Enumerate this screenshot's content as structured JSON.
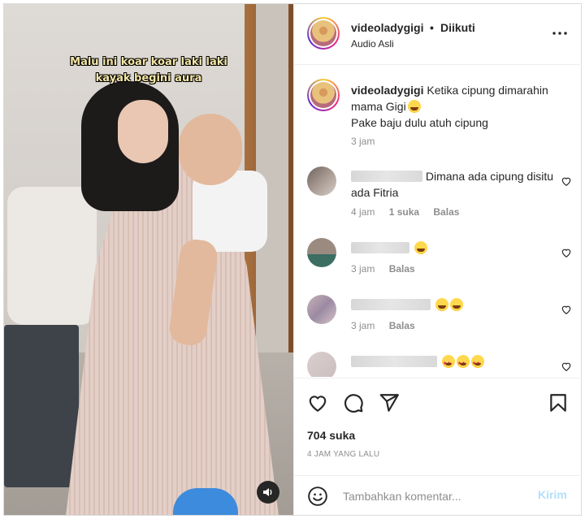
{
  "video": {
    "overlay_caption_line1": "Malu ini koar koar laki laki",
    "overlay_caption_line2": "kayak begini aura"
  },
  "header": {
    "username": "videoladygigi",
    "separator": "•",
    "follow_status": "Diikuti",
    "audio": "Audio Asli"
  },
  "caption": {
    "username": "videoladygigi",
    "text_line1": "Ketika cipung dimarahin mama Gigi",
    "text_line2": "Pake baju dulu atuh cipung",
    "time": "3 jam"
  },
  "comments": [
    {
      "text": "Dimana ada cipung disitu ada Fitria",
      "time": "4 jam",
      "likes": "1 suka",
      "reply": "Balas"
    },
    {
      "text": "",
      "time": "3 jam",
      "reply": "Balas"
    },
    {
      "text": "",
      "time": "3 jam",
      "reply": "Balas"
    },
    {
      "text": ""
    }
  ],
  "actions": {
    "likes": "704 suka",
    "posted_ago": "4 JAM YANG LALU"
  },
  "composer": {
    "placeholder": "Tambahkan komentar...",
    "post_label": "Kirim"
  },
  "colors": {
    "post_button_disabled": "#b2dffc",
    "muted_text": "#8e8e8e",
    "caption_overlay": "#f4e6a6"
  }
}
